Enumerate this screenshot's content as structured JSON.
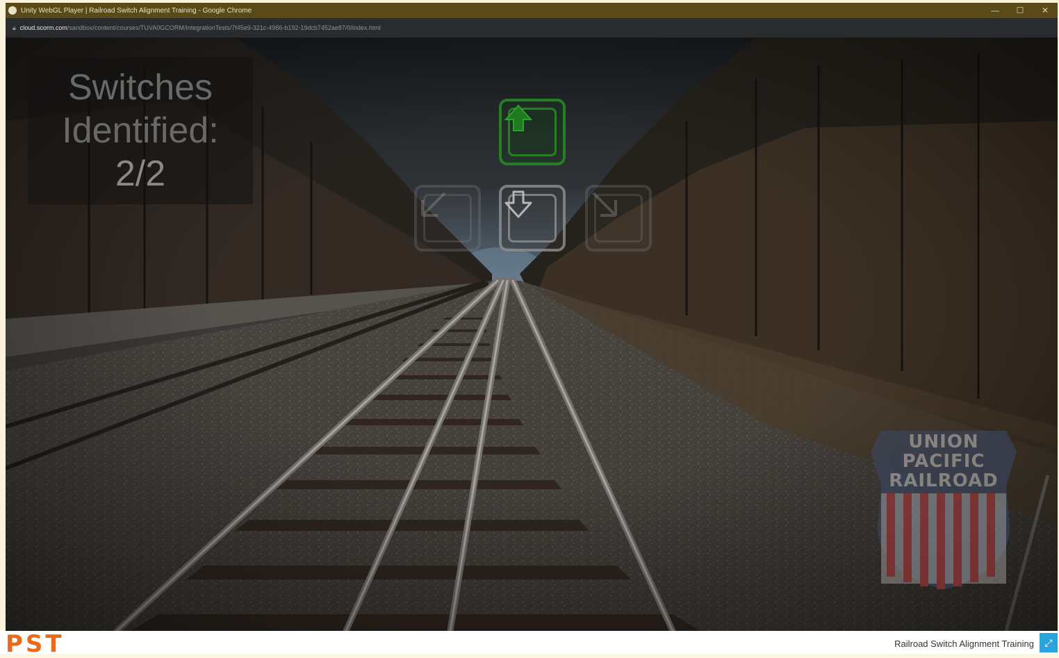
{
  "browser": {
    "title": "Unity WebGL Player | Railroad Switch Alignment Training - Google Chrome",
    "url_host": "cloud.scorm.com",
    "url_path": "/sandbox/content/courses/TUVA0GCORM/IntegrationTests/7f45e9-321c-4986-b192-19dcb7452ae87/0/index.html",
    "minimize_icon": "minimize-icon",
    "maximize_icon": "maximize-icon",
    "close_icon": "close-icon",
    "minimize_label": "—",
    "maximize_label": "☐",
    "close_label": "✕"
  },
  "game": {
    "switches_label_line1": "Switches",
    "switches_label_line2": "Identified:",
    "switches_count": "2/2",
    "controls": {
      "up": {
        "icon": "arrow-up-icon",
        "state": "active",
        "color": "#2e8b2e"
      },
      "down": {
        "icon": "arrow-down-icon",
        "state": "enabled"
      },
      "left": {
        "icon": "arrow-left-icon",
        "state": "disabled"
      },
      "right": {
        "icon": "arrow-right-icon",
        "state": "disabled"
      }
    },
    "watermark": {
      "line1": "UNION",
      "line2": "PACIFIC",
      "line3": "RAILROAD"
    }
  },
  "footer": {
    "logo_text": "PST",
    "logo_color": "#e86a1a",
    "course_title": "Railroad Switch Alignment Training",
    "fullscreen_icon": "fullscreen-icon",
    "fullscreen_label": "⤢",
    "fullscreen_color": "#2aa3dc"
  }
}
